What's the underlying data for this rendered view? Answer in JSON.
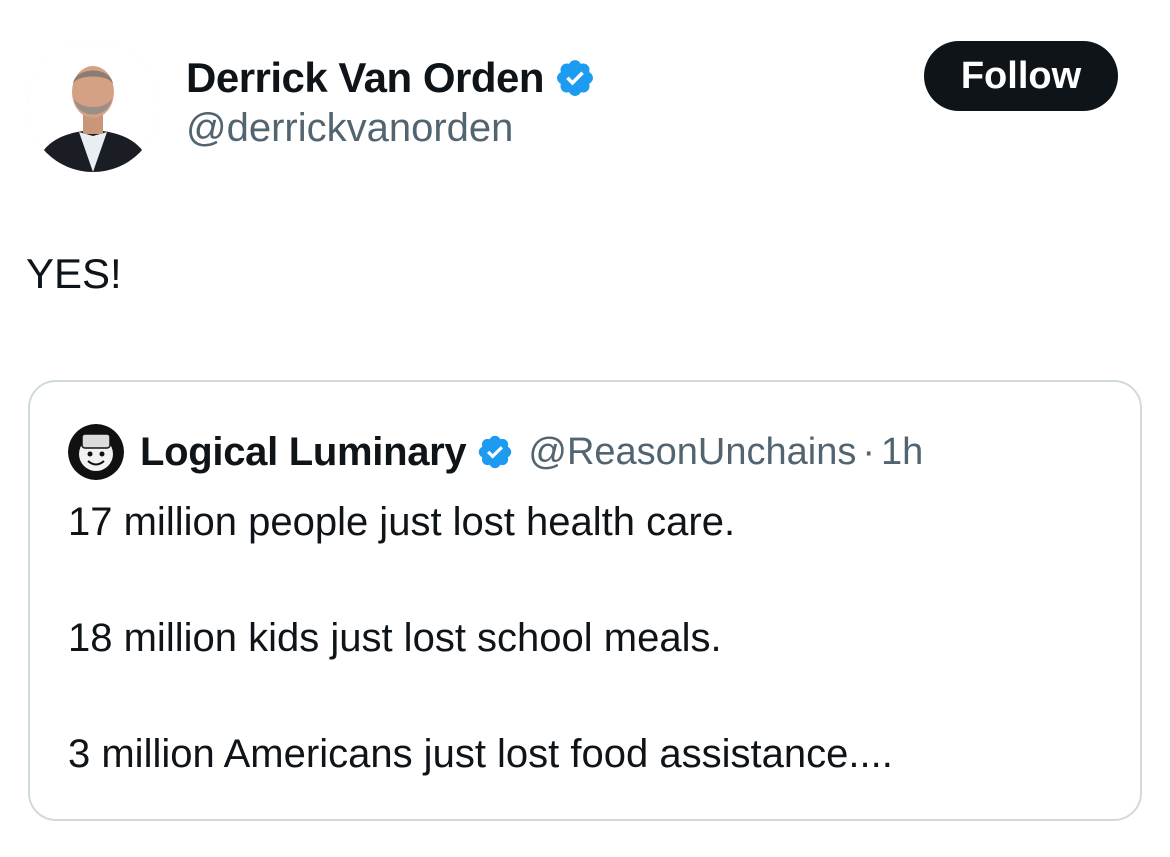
{
  "author": {
    "display_name": "Derrick Van Orden",
    "handle": "@derrickvanorden",
    "verified": true,
    "avatar_icon": "profile-photo-man-in-suit"
  },
  "follow_button": {
    "label": "Follow"
  },
  "tweet": {
    "text": "YES!"
  },
  "quoted_tweet": {
    "display_name": "Logical Luminary",
    "handle": "@ReasonUnchains",
    "separator": "·",
    "time": "1h",
    "verified": true,
    "avatar_icon": "cartoon-face-avatar",
    "lines": [
      "17 million people just lost health care.",
      "18 million kids just lost school meals.",
      "3 million Americans just lost food assistance...."
    ]
  },
  "colors": {
    "text_primary": "#0f1419",
    "text_secondary": "#536471",
    "verified_blue": "#1d9bf0",
    "button_bg": "#0f1419",
    "border": "#cfd9de"
  }
}
